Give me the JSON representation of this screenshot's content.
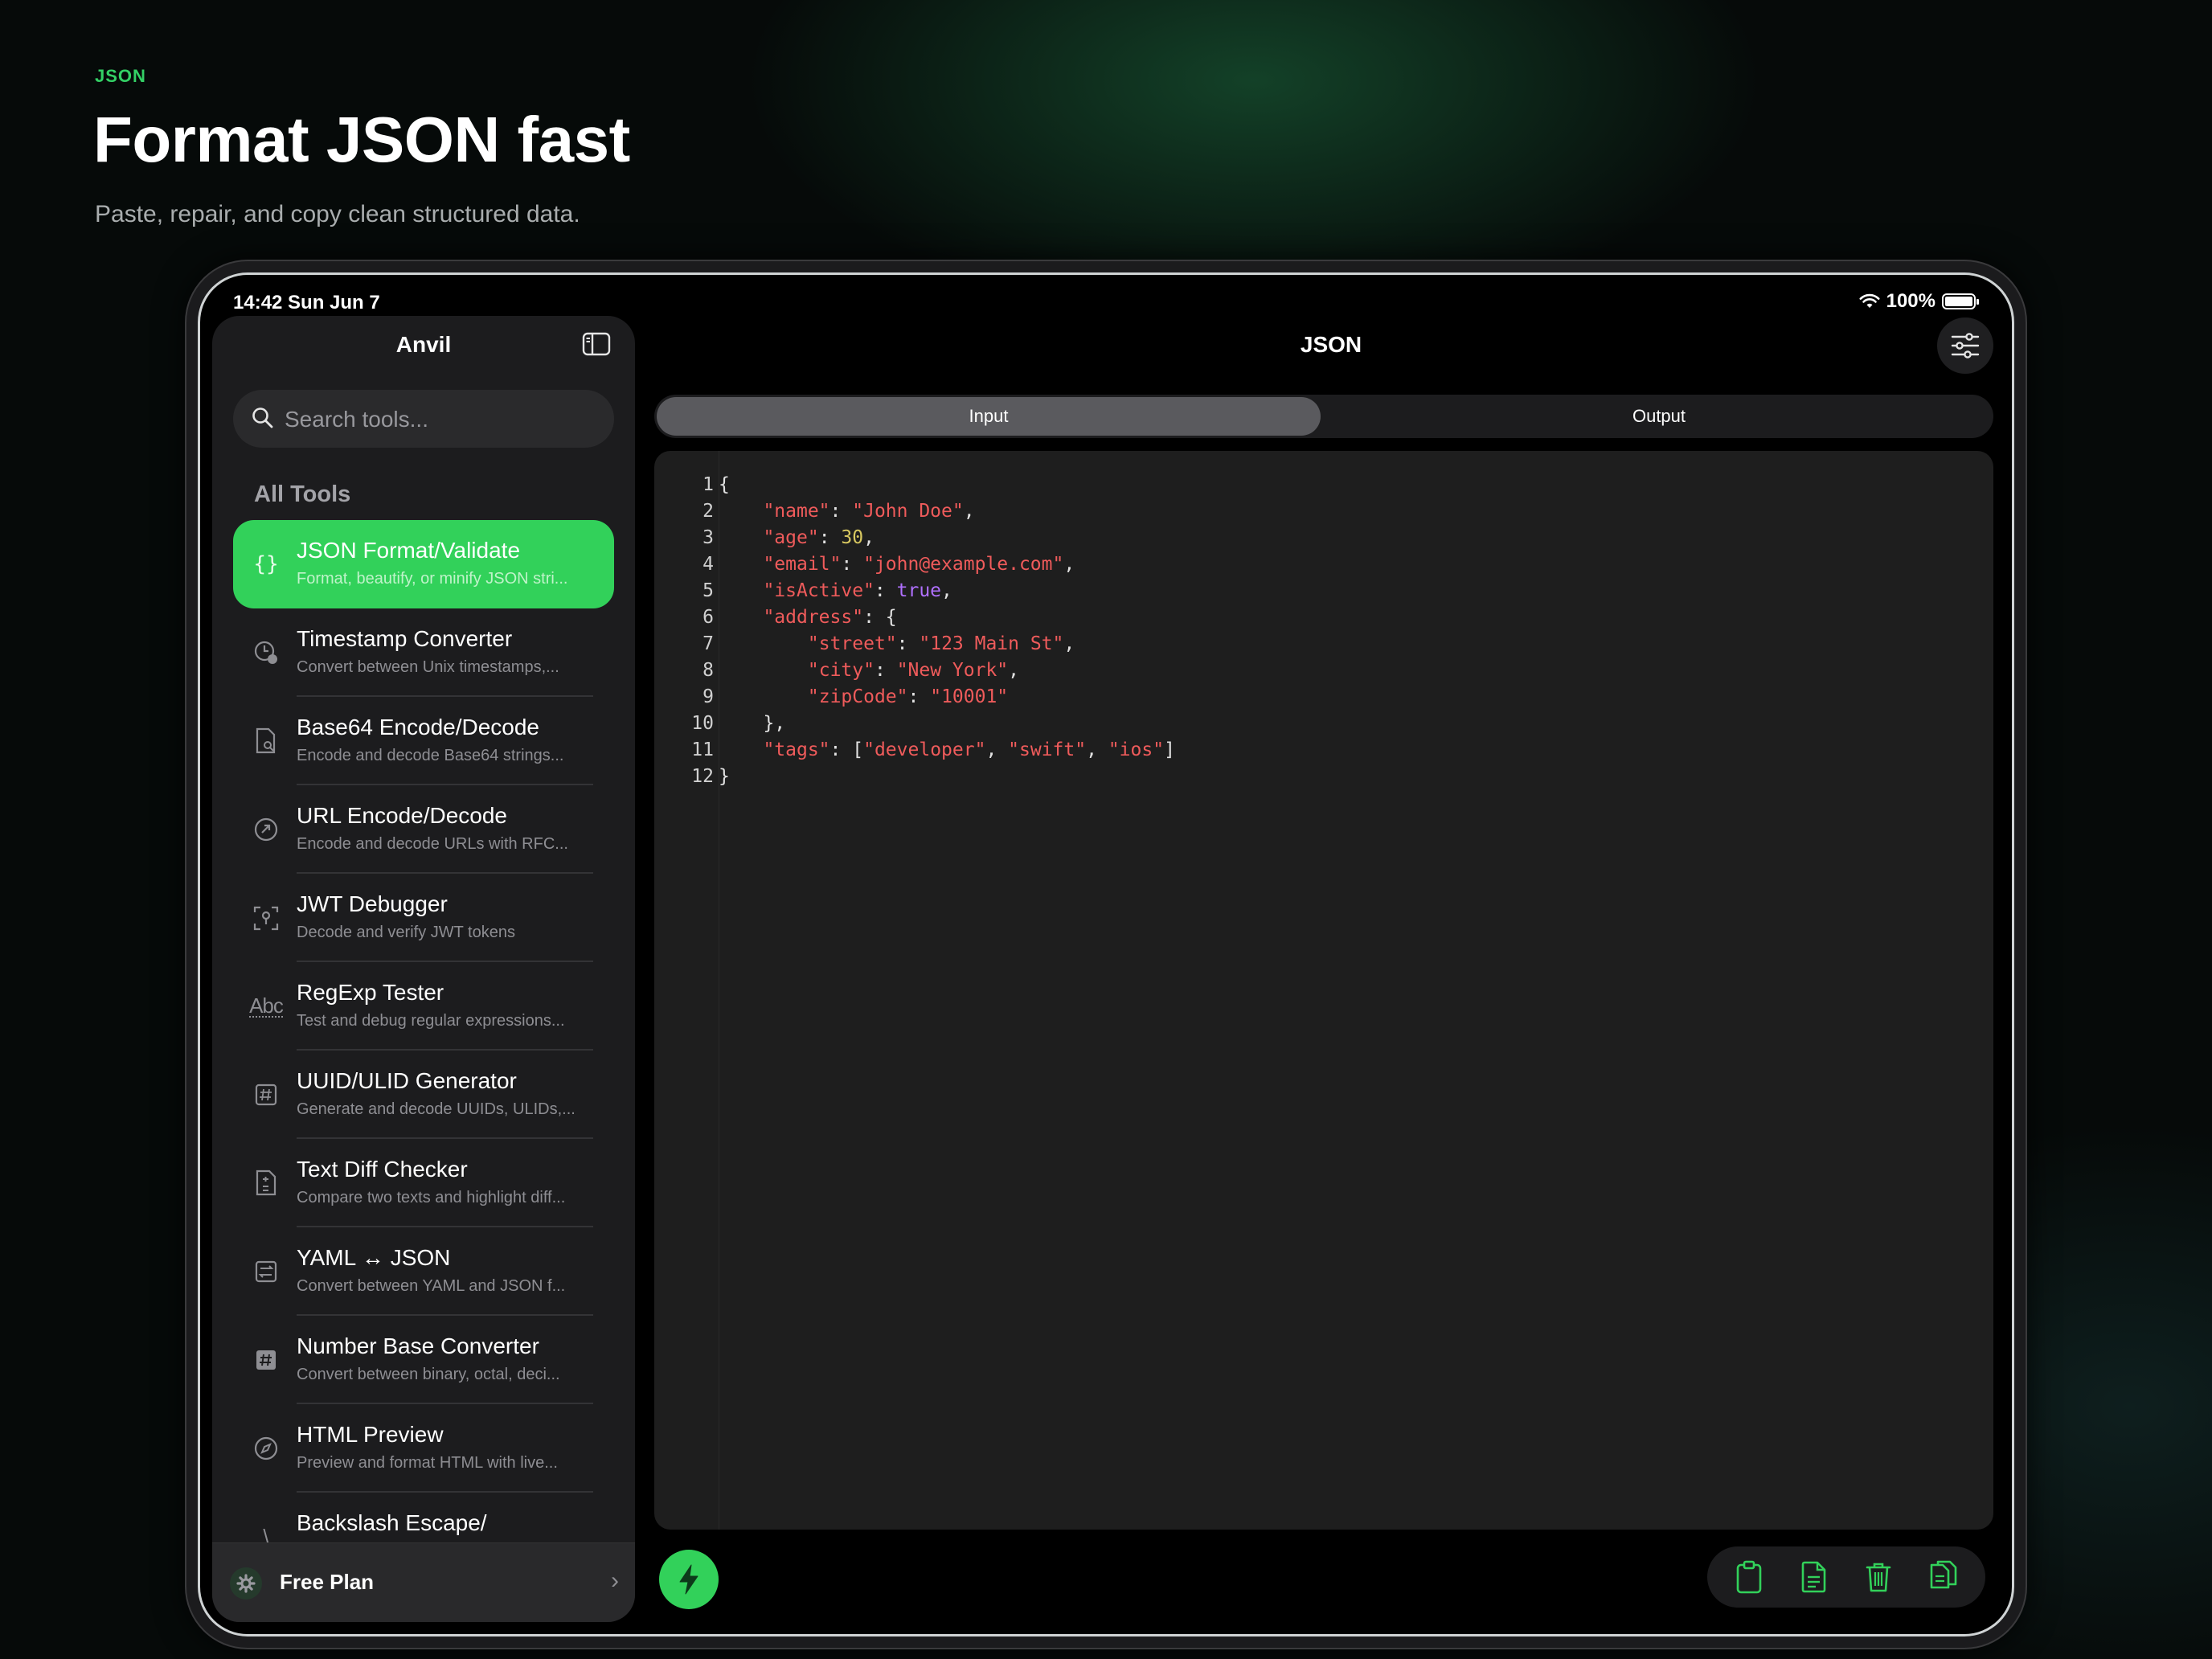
{
  "hero": {
    "eyebrow": "JSON",
    "headline": "Format JSON fast",
    "subtitle": "Paste, repair, and copy clean structured data."
  },
  "status_bar": {
    "time": "14:42  Sun Jun 7",
    "battery": "100%",
    "battery_level": 1.0
  },
  "sidebar": {
    "title": "Anvil",
    "search_placeholder": "Search tools...",
    "section_label": "All Tools",
    "items": [
      {
        "name": "JSON Format/Validate",
        "desc": "Format, beautify, or minify JSON stri...",
        "icon": "braces-icon",
        "active": true
      },
      {
        "name": "Timestamp Converter",
        "desc": "Convert between Unix timestamps,...",
        "icon": "clock-icon"
      },
      {
        "name": "Base64 Encode/Decode",
        "desc": "Encode and decode Base64 strings...",
        "icon": "document-search-icon"
      },
      {
        "name": "URL Encode/Decode",
        "desc": "Encode and decode URLs with RFC...",
        "icon": "link-icon"
      },
      {
        "name": "JWT Debugger",
        "desc": "Decode and verify JWT tokens",
        "icon": "key-scan-icon"
      },
      {
        "name": "RegExp Tester",
        "desc": "Test and debug regular expressions...",
        "icon": "abc-icon"
      },
      {
        "name": "UUID/ULID Generator",
        "desc": "Generate and decode UUIDs, ULIDs,...",
        "icon": "hash-square-icon"
      },
      {
        "name": "Text Diff Checker",
        "desc": "Compare two texts and highlight diff...",
        "icon": "diff-document-icon"
      },
      {
        "name": "YAML ↔ JSON",
        "desc": "Convert between YAML and JSON f...",
        "icon": "swap-icon"
      },
      {
        "name": "Number Base Converter",
        "desc": "Convert between binary, octal, deci...",
        "icon": "number-icon"
      },
      {
        "name": "HTML Preview",
        "desc": "Preview and format HTML with live...",
        "icon": "compass-icon"
      },
      {
        "name": "Backslash Escape/",
        "desc": "",
        "icon": "escape-icon"
      }
    ],
    "plan_label": "Free Plan"
  },
  "main": {
    "title": "JSON",
    "tabs": [
      {
        "label": "Input",
        "selected": true
      },
      {
        "label": "Output",
        "selected": false
      }
    ],
    "editor_lines": [
      {
        "n": "1",
        "code": "{"
      },
      {
        "n": "2",
        "code": "    \"name\": \"John Doe\","
      },
      {
        "n": "3",
        "code": "    \"age\": 30,"
      },
      {
        "n": "4",
        "code": "    \"email\": \"john@example.com\","
      },
      {
        "n": "5",
        "code": "    \"isActive\": true,"
      },
      {
        "n": "6",
        "code": "    \"address\": {"
      },
      {
        "n": "7",
        "code": "        \"street\": \"123 Main St\","
      },
      {
        "n": "8",
        "code": "        \"city\": \"New York\","
      },
      {
        "n": "9",
        "code": "        \"zipCode\": \"10001\""
      },
      {
        "n": "10",
        "code": "    },"
      },
      {
        "n": "11",
        "code": "    \"tags\": [\"developer\", \"swift\", \"ios\"]"
      },
      {
        "n": "12",
        "code": "}"
      }
    ],
    "actions": [
      "paste-icon",
      "document-icon",
      "trash-icon",
      "copy-icon"
    ]
  },
  "colors": {
    "accent": "#32d15a",
    "string": "#ef5b5b",
    "number": "#d8c860",
    "boolean": "#b070ff"
  }
}
